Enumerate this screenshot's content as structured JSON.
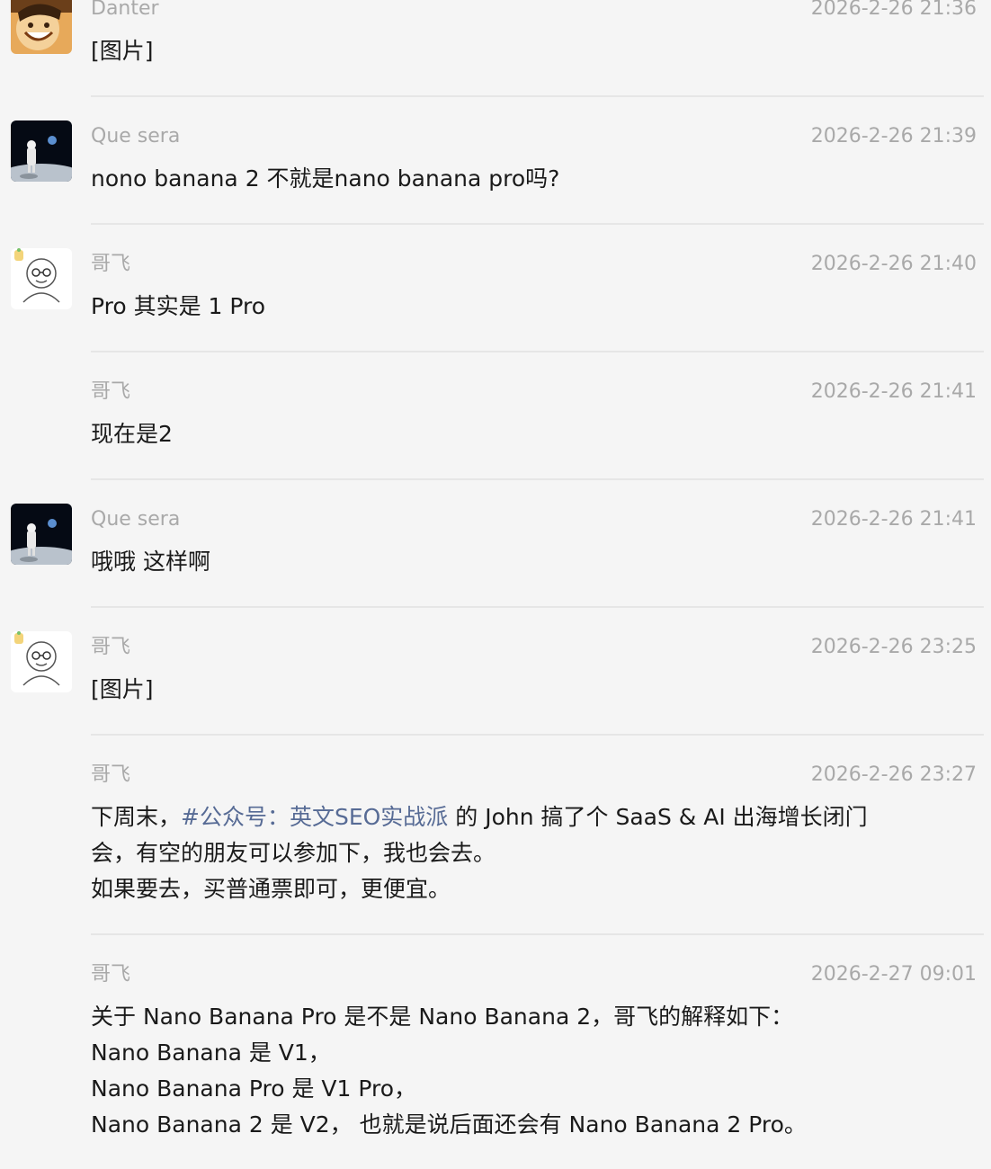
{
  "messages": [
    {
      "sender": "Danter",
      "time": "2026-2-26 21:36",
      "avatar": "cartoon-face-avatar",
      "lines": [
        "[图片]"
      ]
    },
    {
      "sender": "Que sera",
      "time": "2026-2-26 21:39",
      "avatar": "astronaut-moon-avatar",
      "lines": [
        "nono banana 2 不就是nano banana pro吗?"
      ]
    },
    {
      "sender": "哥飞",
      "time": "2026-2-26 21:40",
      "avatar": "glasses-man-sketch-avatar",
      "lines": [
        "Pro 其实是 1 Pro"
      ]
    },
    {
      "sender": "哥飞",
      "time": "2026-2-26 21:41",
      "avatar": "",
      "lines": [
        "现在是2"
      ]
    },
    {
      "sender": "Que sera",
      "time": "2026-2-26 21:41",
      "avatar": "astronaut-moon-avatar",
      "lines": [
        "哦哦 这样啊"
      ]
    },
    {
      "sender": "哥飞",
      "time": "2026-2-26 23:25",
      "avatar": "glasses-man-sketch-avatar",
      "lines": [
        "[图片]"
      ]
    },
    {
      "sender": "哥飞",
      "time": "2026-2-26 23:27",
      "avatar": "",
      "line1_prefix": "下周末，",
      "hashtag": "#公众号：英文SEO实战派",
      "line1_suffix": " 的 John 搞了个 SaaS & AI 出海增长闭门",
      "lines": [
        "会，有空的朋友可以参加下，我也会去。",
        "如果要去，买普通票即可，更便宜。"
      ]
    },
    {
      "sender": "哥飞",
      "time": "2026-2-27 09:01",
      "avatar": "",
      "lines": [
        "关于 Nano Banana Pro 是不是 Nano Banana 2，哥飞的解释如下：",
        "Nano Banana 是 V1，",
        "Nano Banana Pro 是 V1 Pro，",
        "Nano Banana 2 是 V2， 也就是说后面还会有 Nano Banana 2 Pro。"
      ]
    }
  ],
  "colors": {
    "background": "#f5f5f5",
    "meta_text": "#a9a9a9",
    "body_text": "#1a1a1a",
    "hashtag": "#576b95",
    "divider": "#e6e6e6"
  }
}
